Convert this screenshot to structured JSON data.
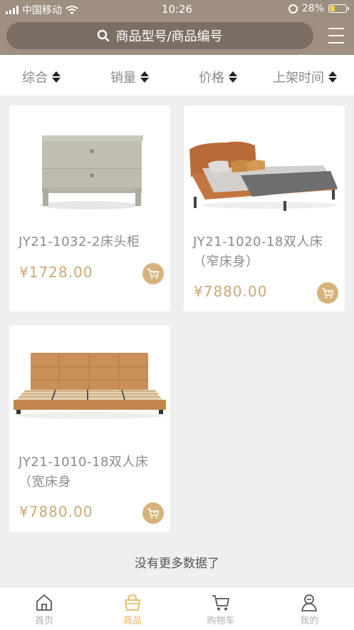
{
  "status_bar": {
    "carrier": "中国移动",
    "time": "10:26",
    "battery": "28%"
  },
  "search": {
    "placeholder": "商品型号/商品编号"
  },
  "sort_bar": [
    {
      "label": "综合"
    },
    {
      "label": "销量"
    },
    {
      "label": "价格"
    },
    {
      "label": "上架时间"
    }
  ],
  "products": [
    {
      "name": "JY21-1032-2床头柜",
      "price": "¥1728.00",
      "image": "nightstand"
    },
    {
      "name": "JY21-1020-18双人床（窄床身）",
      "price": "¥7880.00",
      "image": "double-bed-orange"
    },
    {
      "name": "JY21-1010-18双人床（宽床身",
      "price": "¥7880.00",
      "image": "double-bed-tan"
    }
  ],
  "list_footer": "没有更多数据了",
  "tabbar": [
    {
      "label": "首页",
      "icon": "home-icon"
    },
    {
      "label": "商品",
      "icon": "shopping-bag-icon",
      "active": true
    },
    {
      "label": "购物车",
      "icon": "cart-icon"
    },
    {
      "label": "我的",
      "icon": "user-icon"
    }
  ],
  "colors": {
    "header": "#9e8f80",
    "search_bg": "#7c6e62",
    "accent": "#e9b55a",
    "price": "#c8a978"
  }
}
